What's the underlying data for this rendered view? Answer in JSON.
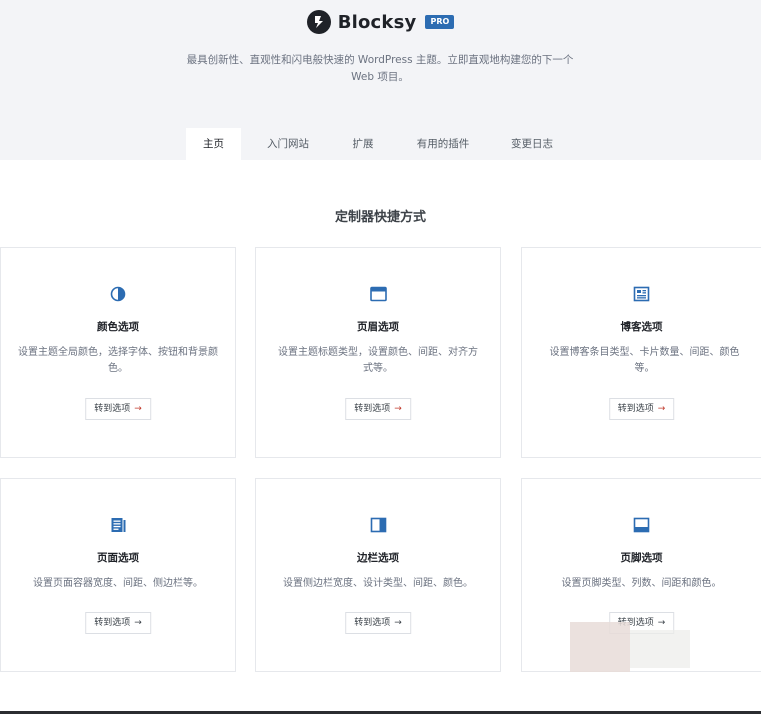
{
  "header": {
    "brand_name": "Blocksy",
    "badge": "PRO",
    "tagline": "最具创新性、直观性和闪电般快速的 WordPress 主题。立即直观地构建您的下一个 Web 项目。"
  },
  "tabs": [
    {
      "label": "主页",
      "active": true
    },
    {
      "label": "入门网站",
      "active": false
    },
    {
      "label": "扩展",
      "active": false
    },
    {
      "label": "有用的插件",
      "active": false
    },
    {
      "label": "变更日志",
      "active": false
    }
  ],
  "section_title": "定制器快捷方式",
  "cards": [
    {
      "title": "颜色选项",
      "icon": "color-drop-icon",
      "description": "设置主题全局颜色，选择字体、按钮和背景颜色。",
      "button": "转到选项",
      "arrow": "→"
    },
    {
      "title": "页眉选项",
      "icon": "header-layout-icon",
      "description": "设置主题标题类型，设置颜色、间距、对齐方式等。",
      "button": "转到选项",
      "arrow": "→"
    },
    {
      "title": "博客选项",
      "icon": "blog-grid-icon",
      "description": "设置博客条目类型、卡片数量、间距、颜色等。",
      "button": "转到选项",
      "arrow": "→"
    },
    {
      "title": "页面选项",
      "icon": "page-layout-icon",
      "description": "设置页面容器宽度、间距、侧边栏等。",
      "button": "转到选项",
      "arrow": "→"
    },
    {
      "title": "边栏选项",
      "icon": "sidebar-layout-icon",
      "description": "设置侧边栏宽度、设计类型、间距、颜色。",
      "button": "转到选项",
      "arrow": "→"
    },
    {
      "title": "页脚选项",
      "icon": "footer-layout-icon",
      "description": "设置页脚类型、列数、间距和颜色。",
      "button": "转到选项",
      "arrow": "→"
    }
  ],
  "colors": {
    "accent": "#2c6cb2",
    "background_top": "#f3f4f7",
    "text_dark": "#1f2228",
    "text_muted": "#6b7280"
  }
}
